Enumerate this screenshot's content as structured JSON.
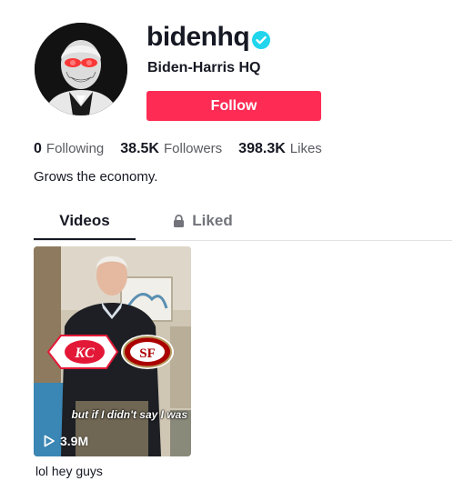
{
  "profile": {
    "username": "bidenhq",
    "display_name": "Biden-Harris HQ",
    "bio": "Grows the economy.",
    "verified_icon": "verified-check-icon",
    "avatar": "avatar-laser-eyes"
  },
  "actions": {
    "follow_label": "Follow"
  },
  "stats": {
    "following": {
      "value": "0",
      "label": "Following"
    },
    "followers": {
      "value": "38.5K",
      "label": "Followers"
    },
    "likes": {
      "value": "398.3K",
      "label": "Likes"
    }
  },
  "tabs": [
    {
      "label": "Videos",
      "active": true
    },
    {
      "label": "Liked",
      "icon": "lock-icon",
      "active": false
    }
  ],
  "videos": [
    {
      "overlay_caption": "but if I didn't say I was",
      "views": "3.9M",
      "description": "lol hey guys"
    }
  ],
  "colors": {
    "accent": "#fe2c55",
    "verified": "#20d5ec",
    "text": "#161823",
    "muted": "#5a5b62"
  }
}
